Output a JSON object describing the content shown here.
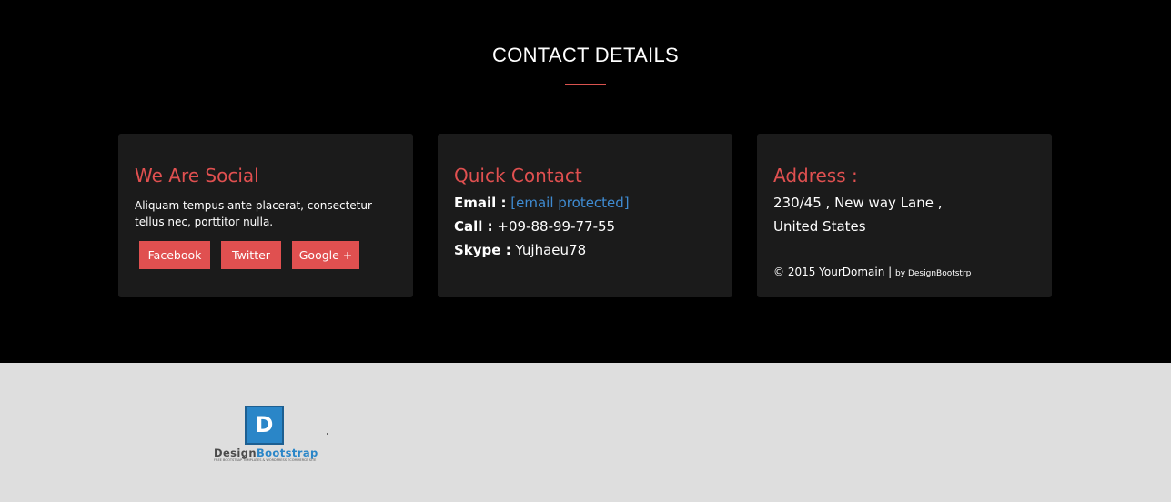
{
  "section": {
    "title": "CONTACT DETAILS"
  },
  "social": {
    "heading": "We Are Social",
    "text": "Aliquam tempus ante placerat, consectetur tellus nec, porttitor nulla.",
    "buttons": {
      "facebook": "Facebook",
      "twitter": "Twitter",
      "google": "Google +"
    }
  },
  "quick": {
    "heading": "Quick Contact",
    "email_label": "Email :",
    "email_value": "[email protected]",
    "call_label": "Call :",
    "call_value": "+09-88-99-77-55",
    "skype_label": "Skype :",
    "skype_value": "Yujhaeu78"
  },
  "address": {
    "heading": "Address :",
    "line1": "230/45 , New way Lane ,",
    "line2": "United States",
    "copyright": "© 2015 YourDomain |",
    "credit": "by DesignBootstrp"
  },
  "footer": {
    "logo_letter": "D",
    "logo_design": "Design",
    "logo_bootstrap": "Bootstrap",
    "logo_tagline": "FREE BOOTSTRAP TEMPLATES & WORDPRESS ECOMMERCE SITE"
  },
  "colors": {
    "accent": "#e05050",
    "link": "#3f8bd1",
    "card": "#1b1b1b",
    "footer": "#dedede"
  }
}
